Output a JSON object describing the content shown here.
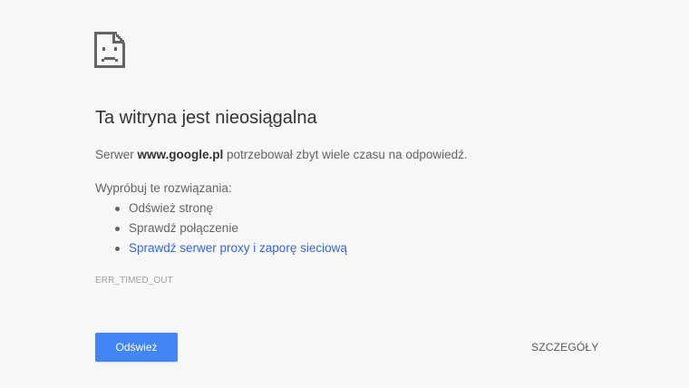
{
  "icon": "sad-page-icon",
  "colors": {
    "background": "#f7f7f7",
    "title": "#333333",
    "text": "#646464",
    "link": "#3367d6",
    "button": "#4285f4",
    "error_code": "#a0a0a0"
  },
  "error": {
    "title": "Ta witryna jest nieosiągalna",
    "desc_prefix": "Serwer ",
    "host": "www.google.pl",
    "desc_suffix": " potrzebował zbyt wiele czasu na odpowiedź.",
    "suggestions_heading": "Wypróbuj te rozwiązania:",
    "suggestions": [
      {
        "text": "Odśwież stronę"
      },
      {
        "text": "Sprawdź połączenie"
      },
      {
        "text": "Sprawdź serwer proxy i zaporę sieciową"
      }
    ],
    "code": "ERR_TIMED_OUT"
  },
  "buttons": {
    "reload": "Odśwież",
    "details": "SZCZEGÓŁY"
  }
}
